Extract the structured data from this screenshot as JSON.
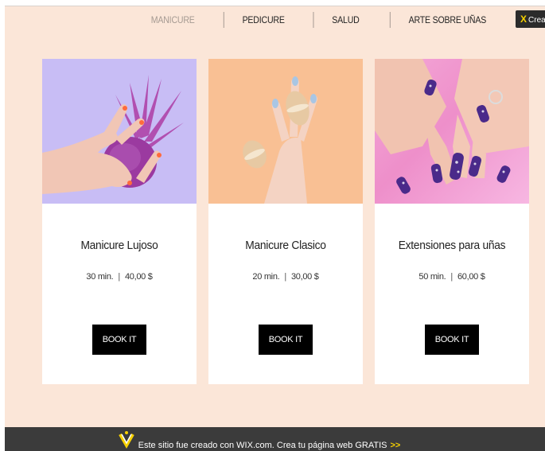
{
  "nav": {
    "items": [
      {
        "label": "MANICURE",
        "active": true
      },
      {
        "label": "PEDICURE",
        "active": false
      },
      {
        "label": "SALUD",
        "active": false
      },
      {
        "label": "ARTE SOBRE UÑAS",
        "active": false
      }
    ]
  },
  "wix_tag": {
    "label": "Crea"
  },
  "cards": [
    {
      "title": "Manicure Lujoso",
      "duration": "30 min.",
      "price": "40,00 $",
      "button": "BOOK IT"
    },
    {
      "title": "Manicure Clasico",
      "duration": "20 min.",
      "price": "30,00 $",
      "button": "BOOK IT"
    },
    {
      "title": "Extensiones para uñas",
      "duration": "50 min.",
      "price": "60,00 $",
      "button": "BOOK IT"
    }
  ],
  "footer": {
    "text": "Este sitio fue creado con WIX.com. Crea tu página web GRATIS",
    "arrows": ">>"
  },
  "colors": {
    "page_bg": "#fbe6d8",
    "button_bg": "#000000",
    "footer_bg": "#3b3b3b",
    "accent_yellow": "#f7d100"
  }
}
